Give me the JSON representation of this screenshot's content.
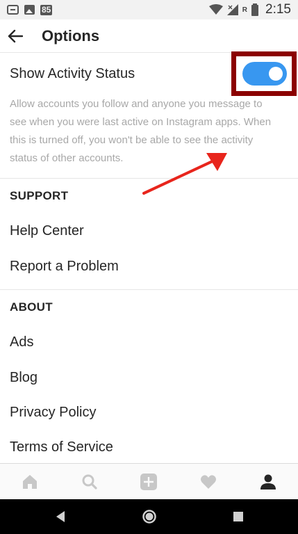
{
  "status_bar": {
    "badge": "85",
    "r_label": "R",
    "time": "2:15"
  },
  "header": {
    "title": "Options"
  },
  "activity": {
    "title": "Show Activity Status",
    "description": "Allow accounts you follow and anyone you message to see when you were last active on Instagram apps. When this is turned off, you won't be able to see the activity status of other accounts.",
    "toggle_on": true,
    "toggle_color": "#3897f0",
    "highlight_color": "#8b0000",
    "arrow_color": "#e8251c"
  },
  "support": {
    "header": "SUPPORT",
    "items": [
      "Help Center",
      "Report a Problem"
    ]
  },
  "about": {
    "header": "ABOUT",
    "items": [
      "Ads",
      "Blog",
      "Privacy Policy",
      "Terms of Service"
    ]
  },
  "tab_bar": {
    "icons": [
      "home-icon",
      "search-icon",
      "add-icon",
      "heart-icon",
      "profile-icon"
    ],
    "active": "profile-icon"
  },
  "nav_bar": {
    "icons": [
      "back-triangle-icon",
      "home-circle-icon",
      "recents-square-icon"
    ]
  }
}
